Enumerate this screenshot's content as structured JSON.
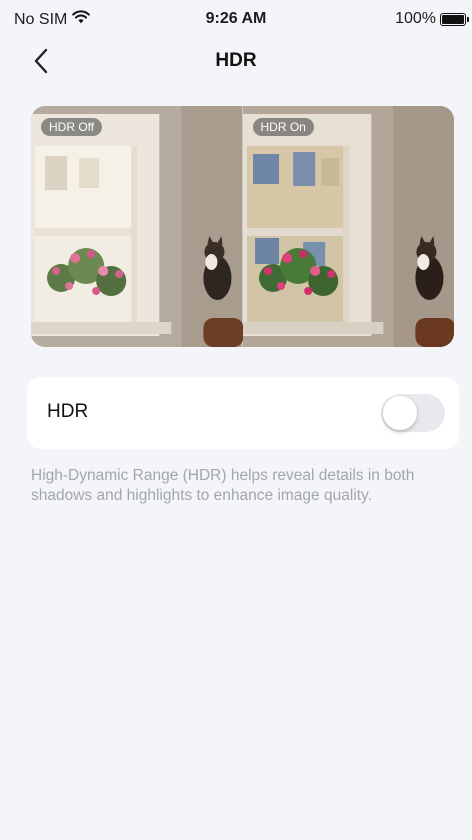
{
  "status_bar": {
    "carrier": "No SIM",
    "time": "9:26 AM",
    "battery": "100%",
    "battery_level": 1.0,
    "wifi_icon": "wifi-icon",
    "battery_icon": "battery-icon"
  },
  "nav": {
    "title": "HDR",
    "back_icon": "chevron-left-icon"
  },
  "preview": {
    "off_label": "HDR Off",
    "on_label": "HDR On"
  },
  "setting": {
    "label": "HDR",
    "enabled": false
  },
  "description": "High-Dynamic Range (HDR) helps reveal details in both shadows and highlights to enhance image quality.",
  "colors": {
    "background": "#f4f5f9",
    "toggle_off": "#e9e9ed",
    "description_text": "#a3a6ae"
  }
}
